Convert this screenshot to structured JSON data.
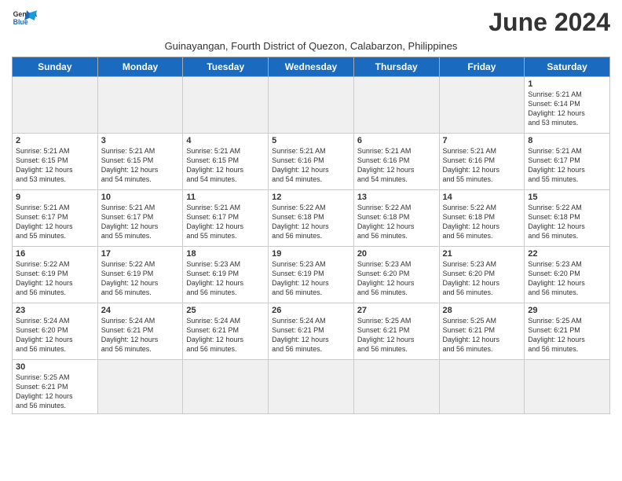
{
  "header": {
    "logo_line1": "General",
    "logo_line2": "Blue",
    "month_year": "June 2024",
    "subtitle": "Guinayangan, Fourth District of Quezon, Calabarzon, Philippines"
  },
  "weekdays": [
    "Sunday",
    "Monday",
    "Tuesday",
    "Wednesday",
    "Thursday",
    "Friday",
    "Saturday"
  ],
  "weeks": [
    [
      {
        "day": "",
        "info": ""
      },
      {
        "day": "",
        "info": ""
      },
      {
        "day": "",
        "info": ""
      },
      {
        "day": "",
        "info": ""
      },
      {
        "day": "",
        "info": ""
      },
      {
        "day": "",
        "info": ""
      },
      {
        "day": "1",
        "info": "Sunrise: 5:21 AM\nSunset: 6:14 PM\nDaylight: 12 hours\nand 53 minutes."
      }
    ],
    [
      {
        "day": "2",
        "info": "Sunrise: 5:21 AM\nSunset: 6:15 PM\nDaylight: 12 hours\nand 53 minutes."
      },
      {
        "day": "3",
        "info": "Sunrise: 5:21 AM\nSunset: 6:15 PM\nDaylight: 12 hours\nand 54 minutes."
      },
      {
        "day": "4",
        "info": "Sunrise: 5:21 AM\nSunset: 6:15 PM\nDaylight: 12 hours\nand 54 minutes."
      },
      {
        "day": "5",
        "info": "Sunrise: 5:21 AM\nSunset: 6:16 PM\nDaylight: 12 hours\nand 54 minutes."
      },
      {
        "day": "6",
        "info": "Sunrise: 5:21 AM\nSunset: 6:16 PM\nDaylight: 12 hours\nand 54 minutes."
      },
      {
        "day": "7",
        "info": "Sunrise: 5:21 AM\nSunset: 6:16 PM\nDaylight: 12 hours\nand 55 minutes."
      },
      {
        "day": "8",
        "info": "Sunrise: 5:21 AM\nSunset: 6:17 PM\nDaylight: 12 hours\nand 55 minutes."
      }
    ],
    [
      {
        "day": "9",
        "info": "Sunrise: 5:21 AM\nSunset: 6:17 PM\nDaylight: 12 hours\nand 55 minutes."
      },
      {
        "day": "10",
        "info": "Sunrise: 5:21 AM\nSunset: 6:17 PM\nDaylight: 12 hours\nand 55 minutes."
      },
      {
        "day": "11",
        "info": "Sunrise: 5:21 AM\nSunset: 6:17 PM\nDaylight: 12 hours\nand 55 minutes."
      },
      {
        "day": "12",
        "info": "Sunrise: 5:22 AM\nSunset: 6:18 PM\nDaylight: 12 hours\nand 56 minutes."
      },
      {
        "day": "13",
        "info": "Sunrise: 5:22 AM\nSunset: 6:18 PM\nDaylight: 12 hours\nand 56 minutes."
      },
      {
        "day": "14",
        "info": "Sunrise: 5:22 AM\nSunset: 6:18 PM\nDaylight: 12 hours\nand 56 minutes."
      },
      {
        "day": "15",
        "info": "Sunrise: 5:22 AM\nSunset: 6:18 PM\nDaylight: 12 hours\nand 56 minutes."
      }
    ],
    [
      {
        "day": "16",
        "info": "Sunrise: 5:22 AM\nSunset: 6:19 PM\nDaylight: 12 hours\nand 56 minutes."
      },
      {
        "day": "17",
        "info": "Sunrise: 5:22 AM\nSunset: 6:19 PM\nDaylight: 12 hours\nand 56 minutes."
      },
      {
        "day": "18",
        "info": "Sunrise: 5:23 AM\nSunset: 6:19 PM\nDaylight: 12 hours\nand 56 minutes."
      },
      {
        "day": "19",
        "info": "Sunrise: 5:23 AM\nSunset: 6:19 PM\nDaylight: 12 hours\nand 56 minutes."
      },
      {
        "day": "20",
        "info": "Sunrise: 5:23 AM\nSunset: 6:20 PM\nDaylight: 12 hours\nand 56 minutes."
      },
      {
        "day": "21",
        "info": "Sunrise: 5:23 AM\nSunset: 6:20 PM\nDaylight: 12 hours\nand 56 minutes."
      },
      {
        "day": "22",
        "info": "Sunrise: 5:23 AM\nSunset: 6:20 PM\nDaylight: 12 hours\nand 56 minutes."
      }
    ],
    [
      {
        "day": "23",
        "info": "Sunrise: 5:24 AM\nSunset: 6:20 PM\nDaylight: 12 hours\nand 56 minutes."
      },
      {
        "day": "24",
        "info": "Sunrise: 5:24 AM\nSunset: 6:21 PM\nDaylight: 12 hours\nand 56 minutes."
      },
      {
        "day": "25",
        "info": "Sunrise: 5:24 AM\nSunset: 6:21 PM\nDaylight: 12 hours\nand 56 minutes."
      },
      {
        "day": "26",
        "info": "Sunrise: 5:24 AM\nSunset: 6:21 PM\nDaylight: 12 hours\nand 56 minutes."
      },
      {
        "day": "27",
        "info": "Sunrise: 5:25 AM\nSunset: 6:21 PM\nDaylight: 12 hours\nand 56 minutes."
      },
      {
        "day": "28",
        "info": "Sunrise: 5:25 AM\nSunset: 6:21 PM\nDaylight: 12 hours\nand 56 minutes."
      },
      {
        "day": "29",
        "info": "Sunrise: 5:25 AM\nSunset: 6:21 PM\nDaylight: 12 hours\nand 56 minutes."
      }
    ],
    [
      {
        "day": "30",
        "info": "Sunrise: 5:25 AM\nSunset: 6:21 PM\nDaylight: 12 hours\nand 56 minutes."
      },
      {
        "day": "",
        "info": ""
      },
      {
        "day": "",
        "info": ""
      },
      {
        "day": "",
        "info": ""
      },
      {
        "day": "",
        "info": ""
      },
      {
        "day": "",
        "info": ""
      },
      {
        "day": "",
        "info": ""
      }
    ]
  ]
}
